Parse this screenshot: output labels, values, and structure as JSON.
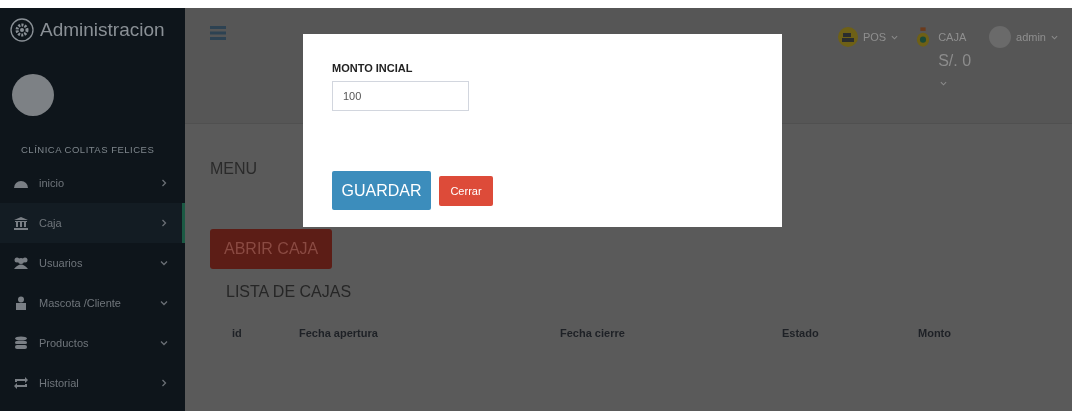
{
  "sidebar": {
    "title": "Administracion",
    "clinic_name": "CLÍNICA COLITAS FELICES",
    "items": [
      {
        "label": "inicio",
        "kind": "link",
        "selected": false
      },
      {
        "label": "Caja",
        "kind": "link",
        "selected": true
      },
      {
        "label": "Usuarios",
        "kind": "submenu",
        "selected": false
      },
      {
        "label": "Mascota /Cliente",
        "kind": "submenu",
        "selected": false
      },
      {
        "label": "Productos",
        "kind": "submenu",
        "selected": false
      },
      {
        "label": "Historial",
        "kind": "link",
        "selected": false
      }
    ]
  },
  "header": {
    "pos": {
      "label": "POS"
    },
    "caja": {
      "label": "CAJA",
      "amount": "S/. 0"
    },
    "user": {
      "label": "admin"
    }
  },
  "content": {
    "title": "MENU",
    "open_button": "ABRIR CAJA",
    "list_title": "LISTA DE CAJAS",
    "columns": [
      "id",
      "Fecha apertura",
      "Fecha cierre",
      "Estado",
      "Monto"
    ]
  },
  "modal": {
    "label": "MONTO INCIAL",
    "value": "100",
    "save_button": "GUARDAR",
    "close_button": "Cerrar"
  }
}
